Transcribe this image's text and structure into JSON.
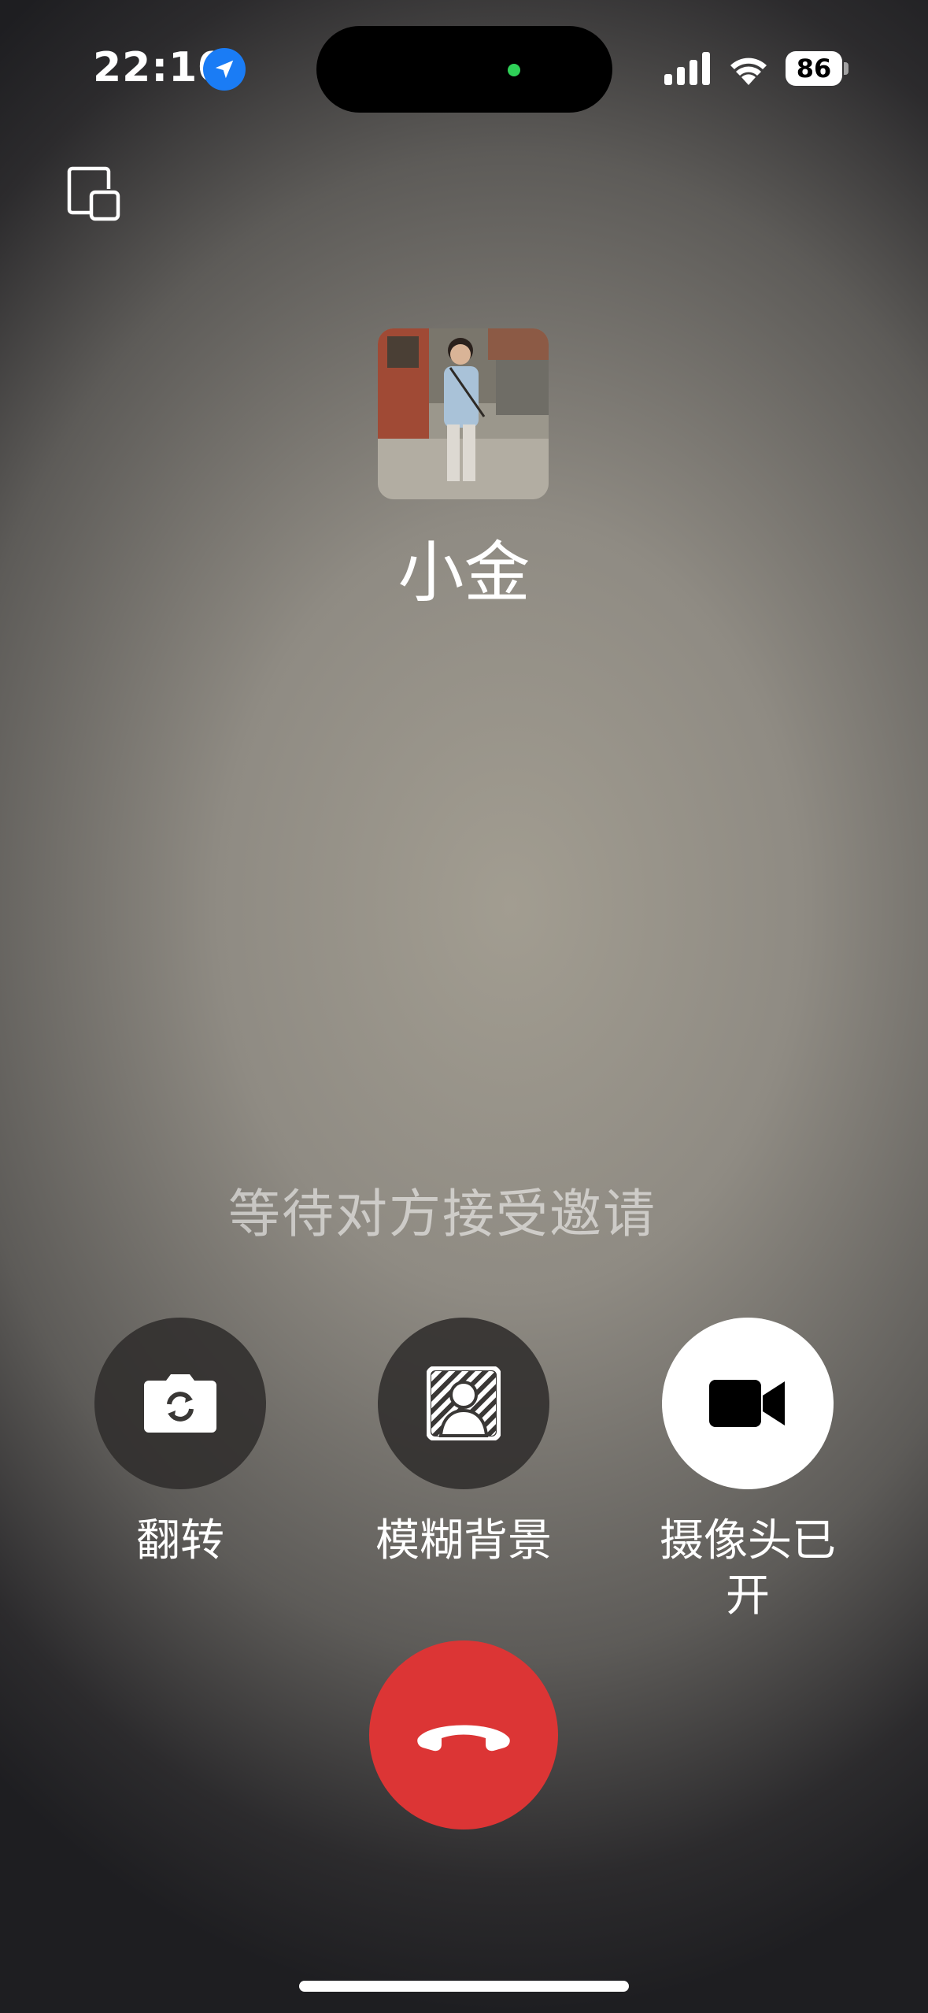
{
  "status_bar": {
    "time": "22:10",
    "battery": "86",
    "icons": [
      "location-arrow-icon",
      "cellular-signal-icon",
      "wifi-icon",
      "battery-icon"
    ]
  },
  "caller": {
    "name": "小金"
  },
  "call_status": "等待对方接受邀请",
  "controls": {
    "flip_label": "翻转",
    "blur_label": "模糊背景",
    "camera_label_line1": "摄像头已",
    "camera_label_line2": "开"
  },
  "colors": {
    "hangup": "#dc3535",
    "location_badge": "#1a7cf5",
    "mic_indicator": "#2fd158"
  }
}
